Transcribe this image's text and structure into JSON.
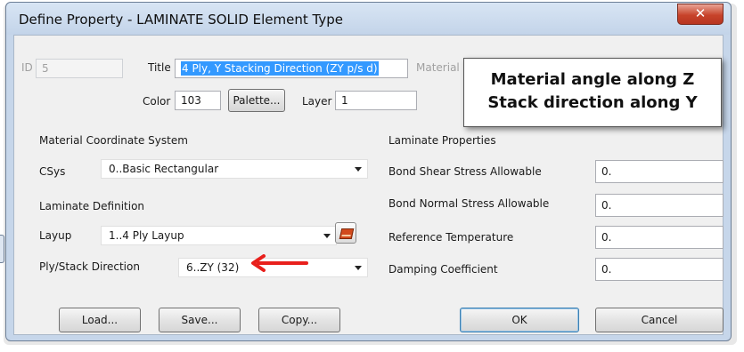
{
  "window": {
    "title": "Define Property - LAMINATE SOLID Element Type",
    "close_glyph": "✕"
  },
  "header": {
    "id_label": "ID",
    "id_value": "5",
    "title_label": "Title",
    "title_value": "4 Ply, Y Stacking Direction (ZY p/s d)",
    "material_label": "Material",
    "color_label": "Color",
    "color_value": "103",
    "palette_button": "Palette...",
    "layer_label": "Layer",
    "layer_value": "1"
  },
  "callout": {
    "line1": "Material angle along Z",
    "line2": "Stack direction along Y"
  },
  "material_coord": {
    "section": "Material Coordinate System",
    "csys_label": "CSys",
    "csys_value": "0..Basic Rectangular"
  },
  "laminate_def": {
    "section": "Laminate Definition",
    "layup_label": "Layup",
    "layup_value": "1..4 Ply Layup",
    "stack_label": "Ply/Stack Direction",
    "stack_value": "6..ZY (32)",
    "layup_icon": "layup-editor-icon"
  },
  "laminate_props": {
    "section": "Laminate Properties",
    "rows": [
      {
        "label": "Bond Shear Stress Allowable",
        "value": "0."
      },
      {
        "label": "Bond Normal Stress Allowable",
        "value": "0."
      },
      {
        "label": "Reference Temperature",
        "value": "0."
      },
      {
        "label": "Damping Coefficient",
        "value": "0."
      }
    ]
  },
  "buttons": {
    "load": "Load...",
    "save": "Save...",
    "copy": "Copy...",
    "ok": "OK",
    "cancel": "Cancel"
  },
  "colors": {
    "titlebar": "#c6d6ea",
    "close": "#c7432b",
    "selection": "#3399ff",
    "arrow": "#e8201c"
  }
}
